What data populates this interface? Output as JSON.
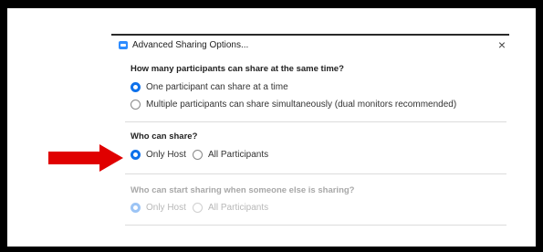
{
  "dialog": {
    "title": "Advanced Sharing Options...",
    "close_glyph": "×",
    "icon": "zoom-app-icon"
  },
  "sections": [
    {
      "heading": "How many participants can share at the same time?",
      "options": [
        {
          "label": "One participant can share at a time",
          "selected": true
        },
        {
          "label": "Multiple participants can share simultaneously (dual monitors recommended)",
          "selected": false
        }
      ],
      "disabled": false
    },
    {
      "heading": "Who can share?",
      "options": [
        {
          "label": "Only Host",
          "selected": true
        },
        {
          "label": "All Participants",
          "selected": false
        }
      ],
      "disabled": false
    },
    {
      "heading": "Who can start sharing when someone else is sharing?",
      "options": [
        {
          "label": "Only Host",
          "selected": true
        },
        {
          "label": "All Participants",
          "selected": false
        }
      ],
      "disabled": true
    }
  ],
  "annotation": {
    "icon": "red-arrow-icon",
    "color": "#e00000"
  },
  "colors": {
    "accent": "#0e71eb",
    "frame": "#000000"
  }
}
